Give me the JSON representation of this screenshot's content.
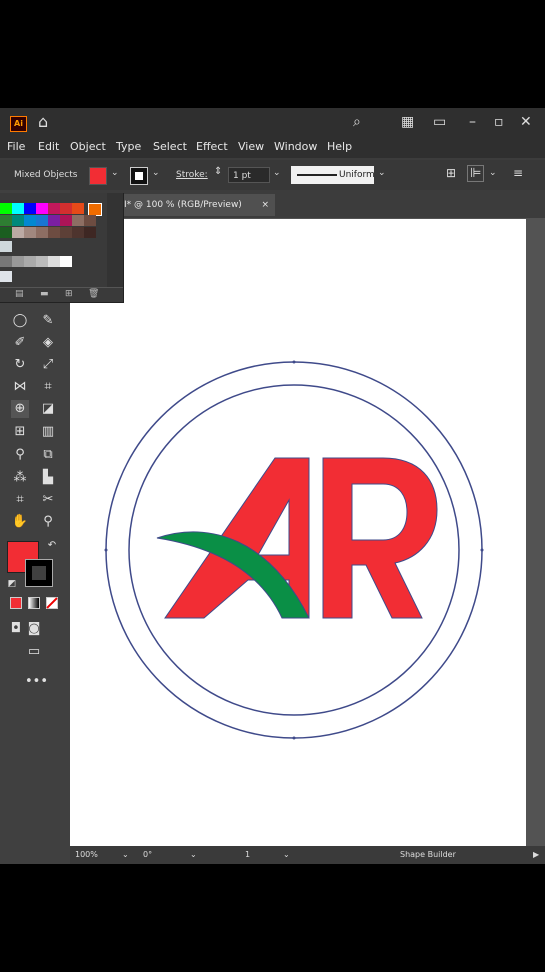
{
  "app": {
    "logo": "Ai"
  },
  "menu": [
    "File",
    "Edit",
    "Object",
    "Type",
    "Select",
    "Effect",
    "View",
    "Window",
    "Help"
  ],
  "control": {
    "selection_label": "Mixed Objects",
    "stroke_label": "Stroke:",
    "stroke_weight": "1 pt",
    "profile": "Uniform",
    "fill_color": "#f22d34"
  },
  "document": {
    "tab_title": "I* @ 100 % (RGB/Preview)",
    "close": "×"
  },
  "status": {
    "zoom": "100%",
    "rotation": "0°",
    "artboard": "1",
    "tool": "Shape Builder"
  },
  "colors": {
    "red": "#f22d34",
    "green": "#0a8f46",
    "path": "#3f4a8a"
  },
  "icons": [
    "search-icon",
    "home-icon",
    "arrange-icon",
    "panel-icon",
    "minimize-icon",
    "maximize-icon",
    "close-icon"
  ]
}
